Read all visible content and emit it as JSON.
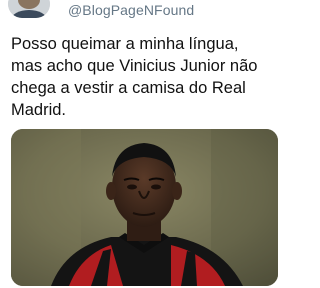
{
  "tweet": {
    "handle": "@BlogPageNFound",
    "avatar_icon": "profile-avatar",
    "text_lines": [
      "Posso queimar a minha língua,",
      "mas acho que Vinicius Junior não",
      "chega a vestir a camisa do Real",
      "Madrid."
    ],
    "media": {
      "kind": "photo-portrait-football-player",
      "jersey_colors": [
        "#b11d20",
        "#141414"
      ],
      "background_color": "#6c6a4e"
    }
  }
}
